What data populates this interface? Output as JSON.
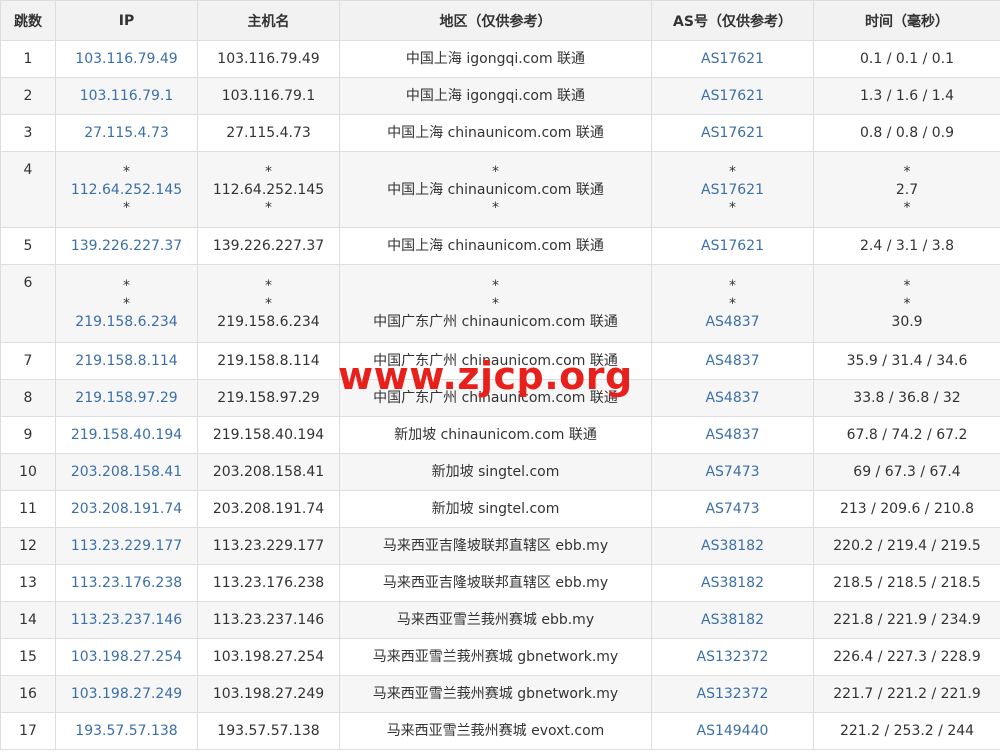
{
  "headers": {
    "hop": "跳数",
    "ip": "IP",
    "host": "主机名",
    "region": "地区（仅供参考）",
    "as": "AS号（仅供参考）",
    "time": "时间（毫秒）"
  },
  "rows": [
    {
      "hop": "1",
      "ip": [
        "103.116.79.49"
      ],
      "host": [
        "103.116.79.49"
      ],
      "region": [
        "中国上海 igongqi.com 联通"
      ],
      "as": [
        "AS17621"
      ],
      "time": [
        "0.1 / 0.1 / 0.1"
      ]
    },
    {
      "hop": "2",
      "ip": [
        "103.116.79.1"
      ],
      "host": [
        "103.116.79.1"
      ],
      "region": [
        "中国上海 igongqi.com 联通"
      ],
      "as": [
        "AS17621"
      ],
      "time": [
        "1.3 / 1.6 / 1.4"
      ]
    },
    {
      "hop": "3",
      "ip": [
        "27.115.4.73"
      ],
      "host": [
        "27.115.4.73"
      ],
      "region": [
        "中国上海 chinaunicom.com 联通"
      ],
      "as": [
        "AS17621"
      ],
      "time": [
        "0.8 / 0.8 / 0.9"
      ]
    },
    {
      "hop": "4",
      "ip": [
        "*",
        "112.64.252.145",
        "*"
      ],
      "host": [
        "*",
        "112.64.252.145",
        "*"
      ],
      "region": [
        "*",
        "中国上海 chinaunicom.com 联通",
        "*"
      ],
      "as": [
        "*",
        "AS17621",
        "*"
      ],
      "time": [
        "*",
        "2.7",
        "*"
      ]
    },
    {
      "hop": "5",
      "ip": [
        "139.226.227.37"
      ],
      "host": [
        "139.226.227.37"
      ],
      "region": [
        "中国上海 chinaunicom.com 联通"
      ],
      "as": [
        "AS17621"
      ],
      "time": [
        "2.4 / 3.1 / 3.8"
      ]
    },
    {
      "hop": "6",
      "ip": [
        "*",
        "*",
        "219.158.6.234"
      ],
      "host": [
        "*",
        "*",
        "219.158.6.234"
      ],
      "region": [
        "*",
        "*",
        "中国广东广州 chinaunicom.com 联通"
      ],
      "as": [
        "*",
        "*",
        "AS4837"
      ],
      "time": [
        "*",
        "*",
        "30.9"
      ]
    },
    {
      "hop": "7",
      "ip": [
        "219.158.8.114"
      ],
      "host": [
        "219.158.8.114"
      ],
      "region": [
        "中国广东广州 chinaunicom.com 联通"
      ],
      "as": [
        "AS4837"
      ],
      "time": [
        "35.9 / 31.4 / 34.6"
      ]
    },
    {
      "hop": "8",
      "ip": [
        "219.158.97.29"
      ],
      "host": [
        "219.158.97.29"
      ],
      "region": [
        "中国广东广州 chinaunicom.com 联通"
      ],
      "as": [
        "AS4837"
      ],
      "time": [
        "33.8 / 36.8 / 32"
      ]
    },
    {
      "hop": "9",
      "ip": [
        "219.158.40.194"
      ],
      "host": [
        "219.158.40.194"
      ],
      "region": [
        "新加坡 chinaunicom.com 联通"
      ],
      "as": [
        "AS4837"
      ],
      "time": [
        "67.8 / 74.2 / 67.2"
      ]
    },
    {
      "hop": "10",
      "ip": [
        "203.208.158.41"
      ],
      "host": [
        "203.208.158.41"
      ],
      "region": [
        "新加坡 singtel.com"
      ],
      "as": [
        "AS7473"
      ],
      "time": [
        "69 / 67.3 / 67.4"
      ]
    },
    {
      "hop": "11",
      "ip": [
        "203.208.191.74"
      ],
      "host": [
        "203.208.191.74"
      ],
      "region": [
        "新加坡 singtel.com"
      ],
      "as": [
        "AS7473"
      ],
      "time": [
        "213 / 209.6 / 210.8"
      ]
    },
    {
      "hop": "12",
      "ip": [
        "113.23.229.177"
      ],
      "host": [
        "113.23.229.177"
      ],
      "region": [
        "马来西亚吉隆坡联邦直辖区 ebb.my"
      ],
      "as": [
        "AS38182"
      ],
      "time": [
        "220.2 / 219.4 / 219.5"
      ]
    },
    {
      "hop": "13",
      "ip": [
        "113.23.176.238"
      ],
      "host": [
        "113.23.176.238"
      ],
      "region": [
        "马来西亚吉隆坡联邦直辖区 ebb.my"
      ],
      "as": [
        "AS38182"
      ],
      "time": [
        "218.5 / 218.5 / 218.5"
      ]
    },
    {
      "hop": "14",
      "ip": [
        "113.23.237.146"
      ],
      "host": [
        "113.23.237.146"
      ],
      "region": [
        "马来西亚雪兰莪州赛城 ebb.my"
      ],
      "as": [
        "AS38182"
      ],
      "time": [
        "221.8 / 221.9 / 234.9"
      ]
    },
    {
      "hop": "15",
      "ip": [
        "103.198.27.254"
      ],
      "host": [
        "103.198.27.254"
      ],
      "region": [
        "马来西亚雪兰莪州赛城 gbnetwork.my"
      ],
      "as": [
        "AS132372"
      ],
      "time": [
        "226.4 / 227.3 / 228.9"
      ]
    },
    {
      "hop": "16",
      "ip": [
        "103.198.27.249"
      ],
      "host": [
        "103.198.27.249"
      ],
      "region": [
        "马来西亚雪兰莪州赛城 gbnetwork.my"
      ],
      "as": [
        "AS132372"
      ],
      "time": [
        "221.7 / 221.2 / 221.9"
      ]
    },
    {
      "hop": "17",
      "ip": [
        "193.57.57.138"
      ],
      "host": [
        "193.57.57.138"
      ],
      "region": [
        "马来西亚雪兰莪州赛城 evoxt.com"
      ],
      "as": [
        "AS149440"
      ],
      "time": [
        "221.2 / 253.2 / 244"
      ]
    }
  ],
  "watermark": "www.zjcp.org",
  "colors": {
    "link": "#3b6fa9",
    "watermark": "#e8201c",
    "header_bg": "#f2f2f2",
    "stripe": "#f6f6f6",
    "border": "#dddddd"
  }
}
